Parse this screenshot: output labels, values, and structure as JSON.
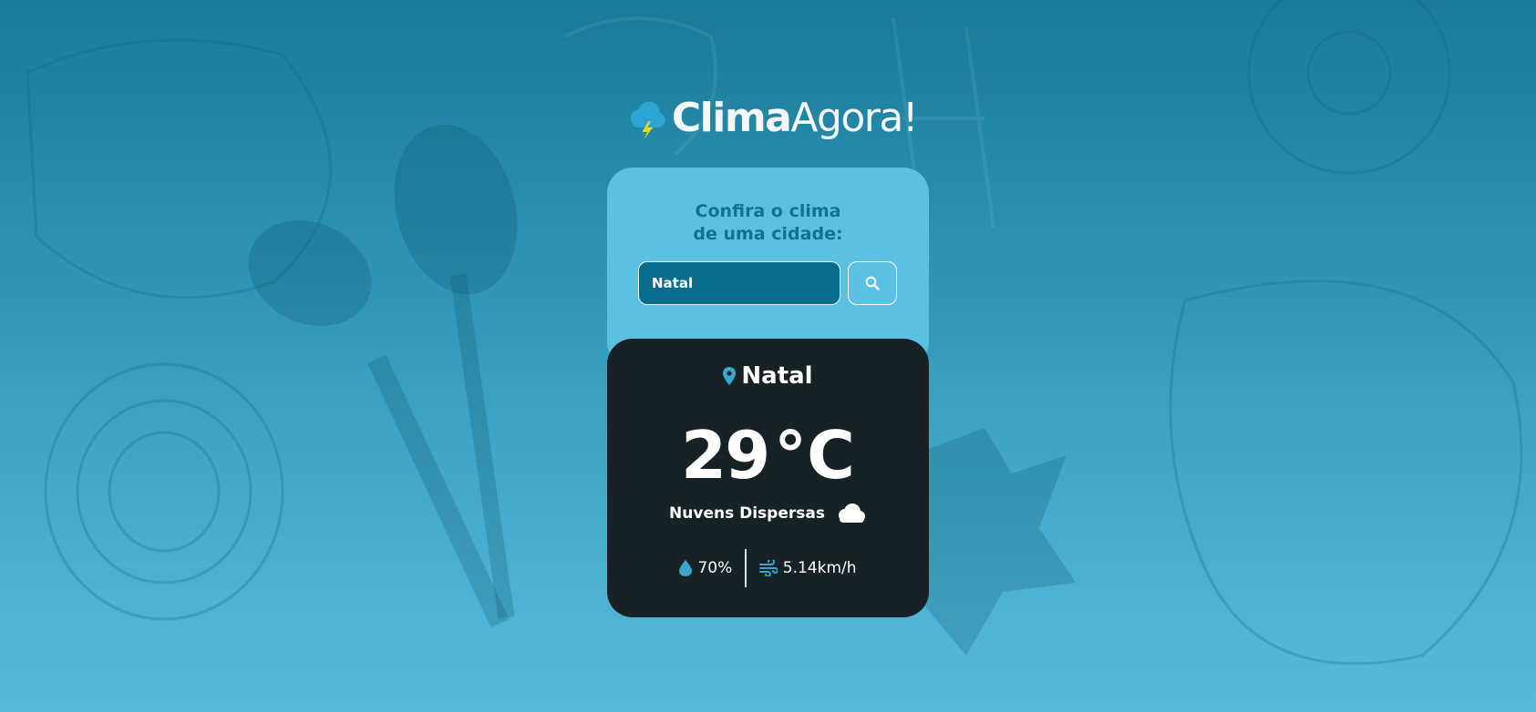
{
  "app": {
    "logo": {
      "name_bold": "Clima",
      "name_light": "Agora!"
    }
  },
  "search": {
    "title_line1": "Confira o clima",
    "title_line2": "de uma cidade:",
    "input_value": "Natal",
    "button_icon": "search-icon"
  },
  "weather": {
    "city": "Natal",
    "temperature": "29",
    "unit": "°C",
    "description": "Nuvens Dispersas",
    "condition_icon": "cloud-icon",
    "humidity": "70%",
    "humidity_icon": "droplet-icon",
    "wind": "5.14km/h",
    "wind_icon": "wind-icon",
    "location_icon": "map-pin-icon"
  },
  "colors": {
    "background_top": "#1a7a98",
    "background_bottom": "#56badb",
    "search_card": "#5ac1e2",
    "search_title": "#15708f",
    "input_bg": "#086c8c",
    "weather_card": "#172226",
    "accent_icon": "#3aa6cf",
    "lightning": "#f4d41f"
  }
}
